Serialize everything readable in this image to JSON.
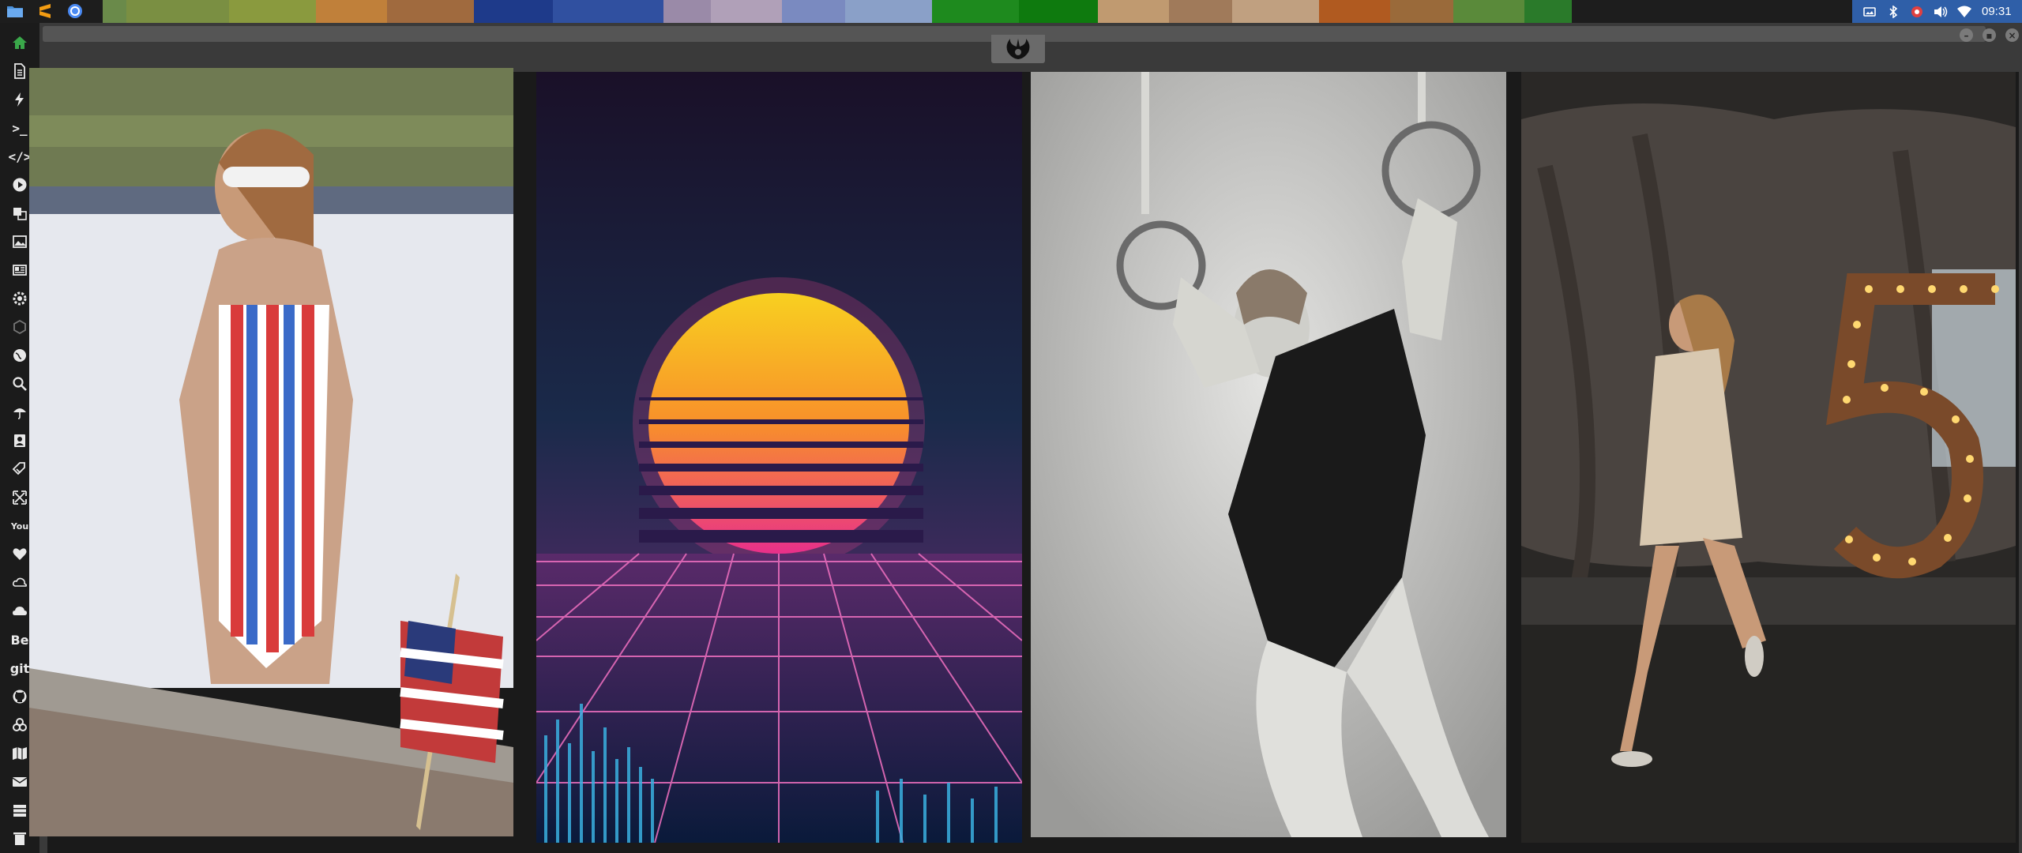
{
  "topbar": {
    "launcher": [
      {
        "name": "files",
        "icon": "folder-icon"
      },
      {
        "name": "sublime",
        "icon": "sublime-text-icon"
      },
      {
        "name": "chrome",
        "icon": "chrome-icon"
      }
    ],
    "colors": [
      "#6a8a4a",
      "#7a8f42",
      "#8a9a3e",
      "#c0803a",
      "#a06a3e",
      "#1e3a8a",
      "#3050a0",
      "#9a8aa8",
      "#b0a0b8",
      "#7a8ac0",
      "#8aa0c8",
      "#1e8a1e",
      "#0e7a0e",
      "#c09a70",
      "#a07a5a",
      "#c0a080",
      "#b05a20",
      "#9a6a3a",
      "#5a8a3a",
      "#2a7a2a"
    ],
    "tray": {
      "icons": [
        "screenshot-icon",
        "bluetooth-icon",
        "security-icon",
        "volume-icon",
        "wifi-icon"
      ],
      "clock": "09:31"
    }
  },
  "dock": [
    {
      "name": "home",
      "icon": "home-icon"
    },
    {
      "name": "document",
      "icon": "document-icon"
    },
    {
      "name": "flash",
      "icon": "lightning-icon"
    },
    {
      "name": "terminal",
      "text": ">_"
    },
    {
      "name": "code",
      "text": "</>"
    },
    {
      "name": "media-player",
      "icon": "play-icon"
    },
    {
      "name": "translate",
      "icon": "translate-icon"
    },
    {
      "name": "images",
      "icon": "image-icon"
    },
    {
      "name": "news",
      "icon": "newspaper-icon"
    },
    {
      "name": "settings",
      "icon": "gear-icon"
    },
    {
      "name": "network",
      "icon": "hexagon-icon"
    },
    {
      "name": "globe",
      "icon": "globe-icon"
    },
    {
      "name": "search",
      "icon": "search-icon"
    },
    {
      "name": "weather",
      "icon": "umbrella-icon"
    },
    {
      "name": "contacts",
      "icon": "contact-icon"
    },
    {
      "name": "tags",
      "icon": "tag-icon"
    },
    {
      "name": "fullscreen",
      "icon": "expand-icon"
    },
    {
      "name": "youtube",
      "text": "You"
    },
    {
      "name": "favorites",
      "icon": "heart-icon"
    },
    {
      "name": "creative-cloud",
      "icon": "creative-cloud-icon"
    },
    {
      "name": "cloud",
      "icon": "cloud-icon"
    },
    {
      "name": "behance",
      "text": "Be"
    },
    {
      "name": "git",
      "text": "git"
    },
    {
      "name": "github",
      "icon": "github-icon"
    },
    {
      "name": "biohazard",
      "icon": "biohazard-icon"
    },
    {
      "name": "map",
      "icon": "map-icon"
    },
    {
      "name": "mail",
      "icon": "mail-icon"
    },
    {
      "name": "storage",
      "icon": "server-icon"
    },
    {
      "name": "trash",
      "icon": "trash-icon"
    }
  ],
  "window": {
    "emblem": "rebel-alliance-icon",
    "controls": [
      "minimize-button",
      "maximize-button",
      "close-button"
    ],
    "gallery": [
      {
        "name": "wallpaper-swimsuit",
        "icon": "photo-icon"
      },
      {
        "name": "wallpaper-retro-sunset",
        "icon": "photo-icon"
      },
      {
        "name": "wallpaper-rings-gymnast",
        "icon": "photo-icon"
      },
      {
        "name": "wallpaper-chanel-5",
        "icon": "photo-icon"
      }
    ]
  }
}
